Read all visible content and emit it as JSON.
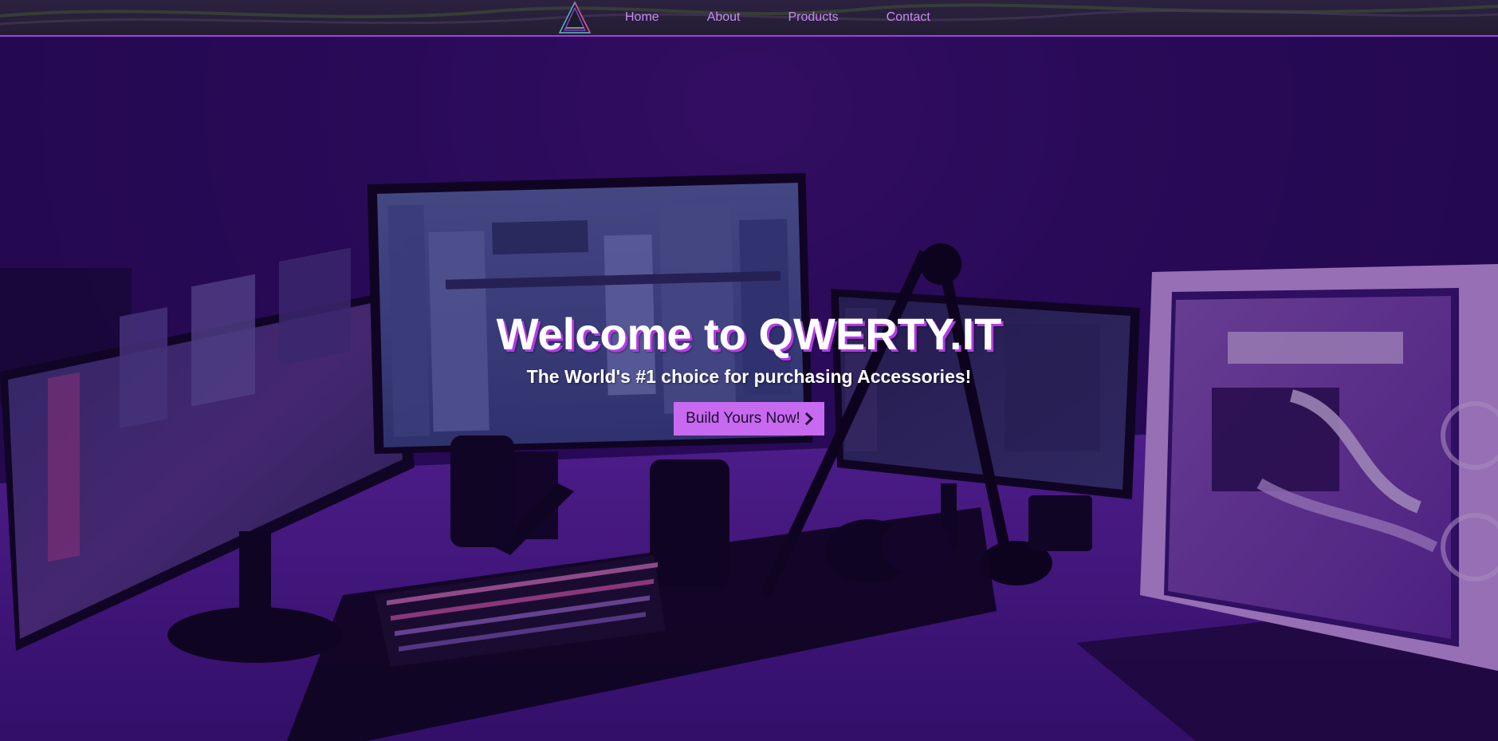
{
  "nav": {
    "logo_icon": "triangle-logo-icon",
    "links": [
      {
        "label": "Home"
      },
      {
        "label": "About"
      },
      {
        "label": "Products"
      },
      {
        "label": "Contact"
      }
    ]
  },
  "hero": {
    "title": "Welcome to QWERTY.IT",
    "subtitle": "The World's #1 choice for purchasing Accessories!",
    "cta_label": "Build Yours Now!",
    "cta_icon": "chevron-right-icon"
  },
  "colors": {
    "nav_bg": "#2a2038",
    "nav_border": "#a23fe0",
    "nav_link": "#c68bf0",
    "accent": "#c76af0",
    "hero_bg": "#2a0a5a"
  }
}
